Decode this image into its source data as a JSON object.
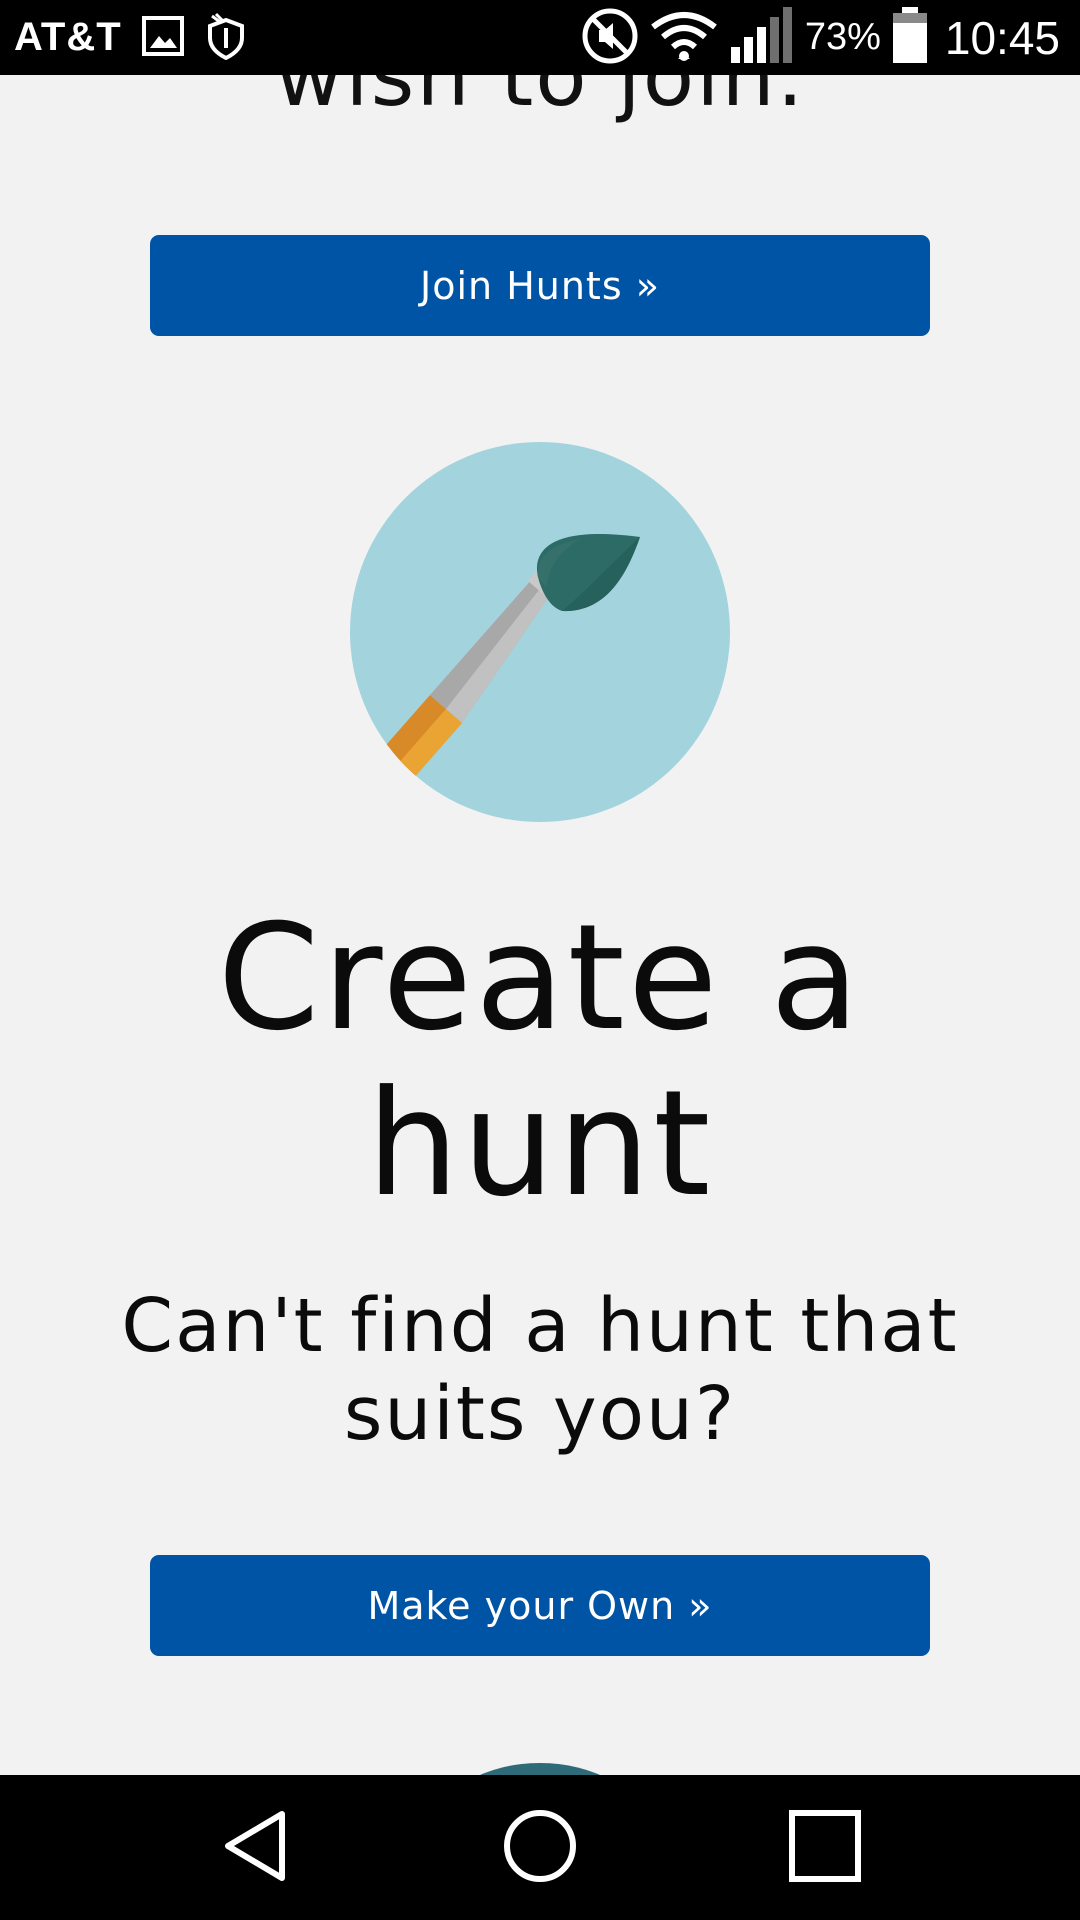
{
  "status_bar": {
    "carrier": "AT&T",
    "battery_percent": "73%",
    "time": "10:45",
    "icons": [
      "image-icon",
      "shield-icon",
      "mute-icon",
      "wifi-icon",
      "signal-icon",
      "battery-icon"
    ]
  },
  "page": {
    "top_cut_text": "wish to join.",
    "join_button": "Join Hunts »",
    "illustration_icon": "paintbrush-icon",
    "headline_line1": "Create a",
    "headline_line2": "hunt",
    "subhead_line1": "Can't find a hunt that",
    "subhead_line2": "suits you?",
    "make_button": "Make your Own »"
  },
  "colors": {
    "button_bg": "#0054a6",
    "page_bg": "#f2f2f3",
    "circle_bg": "#a3d4de",
    "brush_tip": "#2b6b66",
    "ferrule": "#b5b5b5",
    "handle": "#e3a033"
  },
  "nav_bar": {
    "icons": [
      "back-icon",
      "home-icon",
      "recents-icon"
    ]
  }
}
